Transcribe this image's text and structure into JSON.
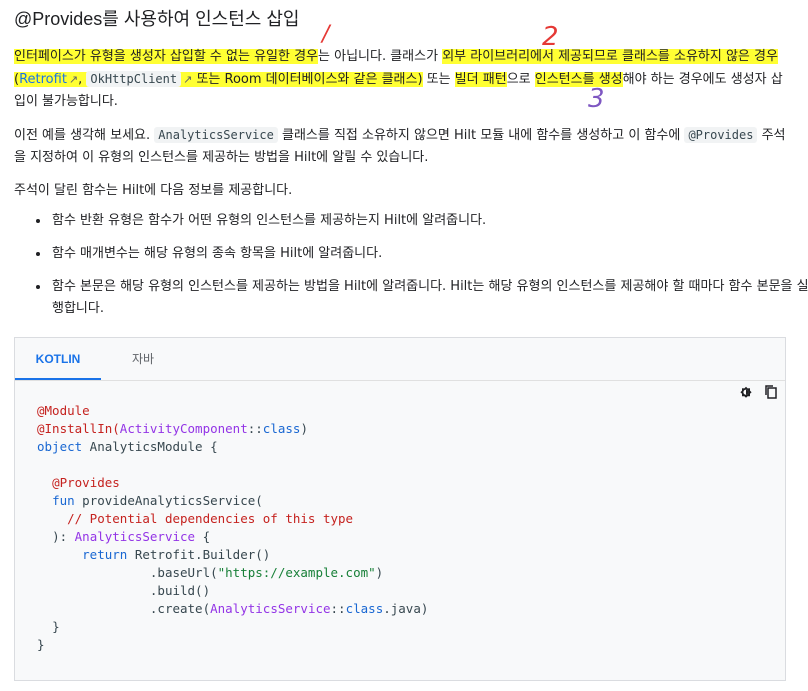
{
  "heading": "@Provides를 사용하여 인스턴스 삽입",
  "para1": {
    "hl1": "인터페이스가 유형을 생성자 삽입할 수 없는 유일한 경우",
    "t1": "는 아닙니다. 클래스가 ",
    "hl2": "외부 라이브러리에서 제공되므로 클래스를 소유하지 않은 경우(",
    "link_retrofit": "Retrofit",
    "sep1": ", ",
    "code_okhttp": "OkHttpClient",
    "t2": " 또는 Room 데이터베이스와 같은 클래스)",
    "t3": " 또는 ",
    "hl3": "빌더 패턴",
    "t4": "으로 ",
    "hl4": "인스턴스를 생성",
    "t5": "해야 하는 경우에도 생성자 삽입이 불가능합니다."
  },
  "para2": {
    "t1": "이전 예를 생각해 보세요. ",
    "code1": "AnalyticsService",
    "t2": " 클래스를 직접 소유하지 않으면 Hilt 모듈 내에 함수를 생성하고 이 함수에 ",
    "code2": "@Provides",
    "t3": " 주석을 지정하여 이 유형의 인스턴스를 제공하는 방법을 Hilt에 알릴 수 있습니다."
  },
  "para3": "주석이 달린 함수는 Hilt에 다음 정보를 제공합니다.",
  "bullets": [
    "함수 반환 유형은 함수가 어떤 유형의 인스턴스를 제공하는지 Hilt에 알려줍니다.",
    "함수 매개변수는 해당 유형의 종속 항목을 Hilt에 알려줍니다.",
    "함수 본문은 해당 유형의 인스턴스를 제공하는 방법을 Hilt에 알려줍니다. Hilt는 해당 유형의 인스턴스를 제공해야 할 때마다 함수 본문을 실행합니다."
  ],
  "annotations": [
    "/",
    "2",
    "3"
  ],
  "tabs": {
    "kotlin": "KOTLIN",
    "java": "자바"
  },
  "icons": {
    "theme": "theme-toggle-icon",
    "copy": "copy-icon"
  },
  "code": {
    "l1": "@Module",
    "l2a": "@InstallIn(",
    "l2b": "ActivityComponent",
    "l2c": "::",
    "l2d": "class",
    "l2e": ")",
    "l3a": "object",
    "l3b": " AnalyticsModule {",
    "l5": "@Provides",
    "l6a": "fun",
    "l6b": " provideAnalyticsService(",
    "l7": "// Potential dependencies of this type",
    "l8a": "): ",
    "l8b": "AnalyticsService",
    "l8c": " {",
    "l9a": "return",
    "l9b": " Retrofit.Builder()",
    "l10a": ".baseUrl(",
    "l10b": "\"https://example.com\"",
    "l10c": ")",
    "l11": ".build()",
    "l12a": ".create(",
    "l12b": "AnalyticsService",
    "l12c": "::",
    "l12d": "class",
    "l12e": ".java)",
    "l13": "}",
    "l14": "}"
  },
  "colors": {
    "highlight": "#ffff33",
    "link": "#1a73e8",
    "annotation": "#e53935"
  }
}
